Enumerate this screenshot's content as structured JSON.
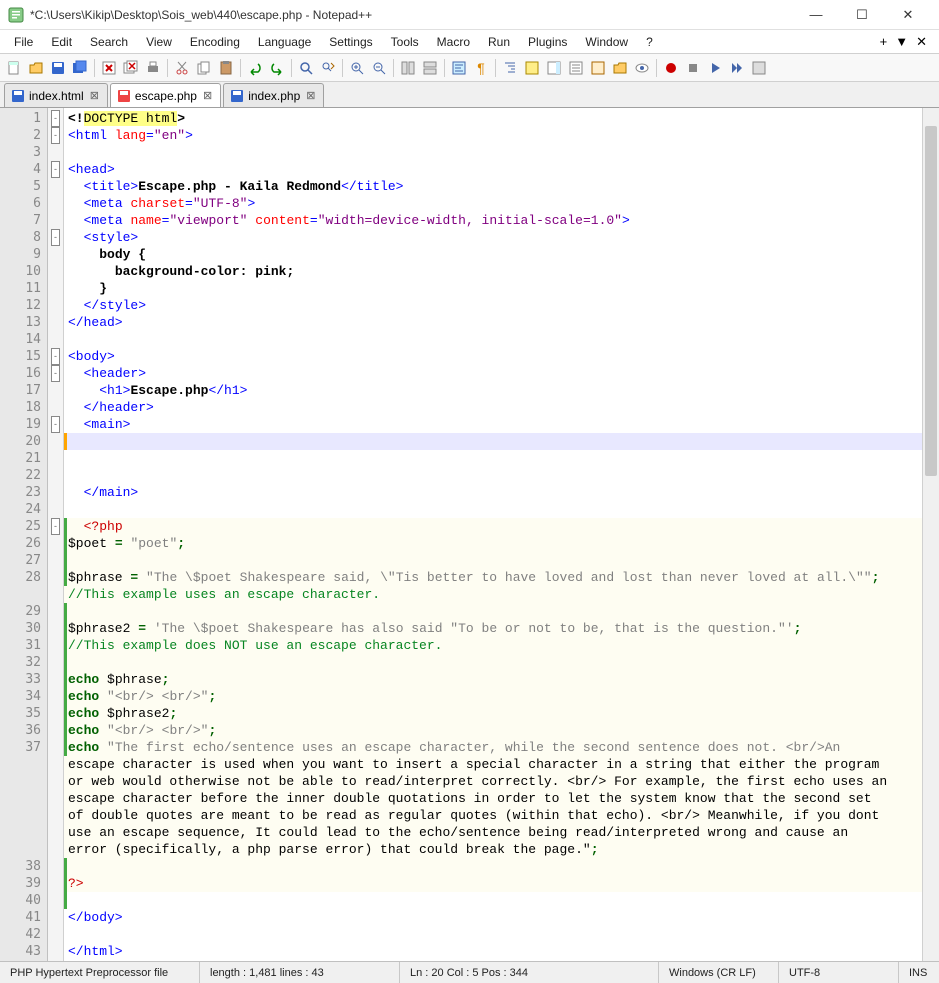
{
  "titlebar": {
    "title": "*C:\\Users\\Kikip\\Desktop\\Sois_web\\440\\escape.php - Notepad++"
  },
  "menubar": {
    "items": [
      "File",
      "Edit",
      "Search",
      "View",
      "Encoding",
      "Language",
      "Settings",
      "Tools",
      "Macro",
      "Run",
      "Plugins",
      "Window",
      "?"
    ]
  },
  "tabs": [
    {
      "label": "index.html",
      "active": false
    },
    {
      "label": "escape.php",
      "active": true
    },
    {
      "label": "index.php",
      "active": false
    }
  ],
  "code": {
    "lines": [
      {
        "n": 1,
        "fold": "-",
        "html": "<span class='t-black'>&lt;!</span><span class='t-doctype-bg'>DOCTYPE html</span><span class='t-black'>&gt;</span>"
      },
      {
        "n": 2,
        "fold": "-",
        "html": "<span class='t-blue'>&lt;html</span> <span class='t-red'>lang</span><span class='t-blue'>=</span><span class='t-purple'>\"en\"</span><span class='t-blue'>&gt;</span>"
      },
      {
        "n": 3,
        "fold": "",
        "html": ""
      },
      {
        "n": 4,
        "fold": "-",
        "html": "<span class='t-blue'>&lt;head&gt;</span>"
      },
      {
        "n": 5,
        "fold": "",
        "html": "  <span class='t-blue'>&lt;title&gt;</span><span class='t-black'>Escape.php - Kaila Redmond</span><span class='t-blue'>&lt;/title&gt;</span>"
      },
      {
        "n": 6,
        "fold": "",
        "html": "  <span class='t-blue'>&lt;meta</span> <span class='t-red'>charset</span><span class='t-blue'>=</span><span class='t-purple'>\"UTF-8\"</span><span class='t-blue'>&gt;</span>"
      },
      {
        "n": 7,
        "fold": "",
        "html": "  <span class='t-blue'>&lt;meta</span> <span class='t-red'>name</span><span class='t-blue'>=</span><span class='t-purple'>\"viewport\"</span> <span class='t-red'>content</span><span class='t-blue'>=</span><span class='t-purple'>\"width=device-width, initial-scale=1.0\"</span><span class='t-blue'>&gt;</span>"
      },
      {
        "n": 8,
        "fold": "-",
        "html": "  <span class='t-blue'>&lt;style&gt;</span>"
      },
      {
        "n": 9,
        "fold": "",
        "html": "    <span class='t-black'>body {</span>"
      },
      {
        "n": 10,
        "fold": "",
        "html": "      <span class='t-black'>background-color: pink;</span>"
      },
      {
        "n": 11,
        "fold": "",
        "html": "    <span class='t-black'>}</span>"
      },
      {
        "n": 12,
        "fold": "",
        "html": "  <span class='t-blue'>&lt;/style&gt;</span>"
      },
      {
        "n": 13,
        "fold": "",
        "html": "<span class='t-blue'>&lt;/head&gt;</span>"
      },
      {
        "n": 14,
        "fold": "",
        "html": ""
      },
      {
        "n": 15,
        "fold": "-",
        "html": "<span class='t-blue'>&lt;body&gt;</span>"
      },
      {
        "n": 16,
        "fold": "-",
        "html": "  <span class='t-blue'>&lt;header&gt;</span>"
      },
      {
        "n": 17,
        "fold": "",
        "html": "    <span class='t-blue'>&lt;h1&gt;</span><span class='t-black'>Escape.php</span><span class='t-blue'>&lt;/h1&gt;</span>"
      },
      {
        "n": 18,
        "fold": "",
        "html": "  <span class='t-blue'>&lt;/header&gt;</span>"
      },
      {
        "n": 19,
        "fold": "-",
        "html": "  <span class='t-blue'>&lt;main&gt;</span>"
      },
      {
        "n": 20,
        "fold": "",
        "cl": "cl20",
        "bar": "o",
        "html": "    "
      },
      {
        "n": 21,
        "fold": "",
        "html": ""
      },
      {
        "n": 22,
        "fold": "",
        "html": ""
      },
      {
        "n": 23,
        "fold": "",
        "html": "  <span class='t-blue'>&lt;/main&gt;</span>"
      },
      {
        "n": 24,
        "fold": "",
        "html": ""
      },
      {
        "n": 25,
        "fold": "-",
        "php": true,
        "bar": "g",
        "html": "  <span class='t-php'>&lt;?php</span>"
      },
      {
        "n": 26,
        "fold": "",
        "php": true,
        "bar": "g",
        "html": "<span class='t-var'>$poet</span> <span class='t-kw'>=</span> <span class='t-str'>\"poet\"</span><span class='t-kw'>;</span>"
      },
      {
        "n": 27,
        "fold": "",
        "php": true,
        "bar": "g",
        "html": ""
      },
      {
        "n": 28,
        "fold": "",
        "php": true,
        "bar": "g",
        "html": "<span class='t-var'>$phrase</span> <span class='t-kw'>=</span> <span class='t-str'>\"The \\$poet Shakespeare said, \\\"Tis better to have loved and lost than never loved at all.\\\"\"</span><span class='t-kw'>;</span>  <br><span class='t-comment'>//This example uses an escape character.</span>"
      },
      {
        "n": 29,
        "fold": "",
        "php": true,
        "bar": "g",
        "html": ""
      },
      {
        "n": 30,
        "fold": "",
        "php": true,
        "bar": "g",
        "html": "<span class='t-var'>$phrase2</span> <span class='t-kw'>=</span> <span class='t-str'>'The \\$poet Shakespeare has also said \"To be or not to be, that is the question.\"'</span><span class='t-kw'>;</span>"
      },
      {
        "n": 31,
        "fold": "",
        "php": true,
        "bar": "g",
        "html": "<span class='t-comment'>//This example does NOT use an escape character.</span>"
      },
      {
        "n": 32,
        "fold": "",
        "php": true,
        "bar": "g",
        "html": ""
      },
      {
        "n": 33,
        "fold": "",
        "php": true,
        "bar": "g",
        "html": "<span class='t-kw'>echo</span> <span class='t-var'>$phrase</span><span class='t-kw'>;</span>"
      },
      {
        "n": 34,
        "fold": "",
        "php": true,
        "bar": "g",
        "html": "<span class='t-kw'>echo</span> <span class='t-str'>\"&lt;br/&gt; &lt;br/&gt;\"</span><span class='t-kw'>;</span>"
      },
      {
        "n": 35,
        "fold": "",
        "php": true,
        "bar": "g",
        "html": "<span class='t-kw'>echo</span> <span class='t-var'>$phrase2</span><span class='t-kw'>;</span>"
      },
      {
        "n": 36,
        "fold": "",
        "php": true,
        "bar": "g",
        "html": "<span class='t-kw'>echo</span> <span class='t-str'>\"&lt;br/&gt; &lt;br/&gt;\"</span><span class='t-kw'>;</span>"
      },
      {
        "n": 37,
        "fold": "",
        "php": true,
        "bar": "g",
        "html": "<span class='t-kw'>echo</span> <span class='t-str'>\"The first echo/sentence uses an escape character, while the second sentence does not. &lt;br/&gt;An <br>escape character is used when you want to insert a special character in a string that either the program <br>or web would otherwise not be able to read/interpret correctly. &lt;br/&gt; For example, the first echo uses an <br>escape character before the inner double quotations in order to let the system know that the second set <br>of double quotes are meant to be read as regular quotes (within that echo). &lt;br/&gt; Meanwhile, if you dont <br>use an escape sequence, It could lead to the echo/sentence being read/interpreted wrong and cause an <br>error (specifically, a php parse error) that could break the page.\"</span><span class='t-kw'>;</span>"
      },
      {
        "n": 38,
        "fold": "",
        "php": true,
        "bar": "g",
        "html": ""
      },
      {
        "n": 39,
        "fold": "",
        "php": true,
        "bar": "g",
        "html": "<span class='t-php'>?&gt;</span>"
      },
      {
        "n": 40,
        "fold": "",
        "bar": "g",
        "html": ""
      },
      {
        "n": 41,
        "fold": "",
        "html": "<span class='t-blue'>&lt;/body&gt;</span>"
      },
      {
        "n": 42,
        "fold": "",
        "html": ""
      },
      {
        "n": 43,
        "fold": "",
        "html": "<span class='t-blue'>&lt;/html&gt;</span>"
      }
    ]
  },
  "statusbar": {
    "filetype": "PHP Hypertext Preprocessor file",
    "length": "length : 1,481    lines : 43",
    "pos": "Ln : 20    Col : 5    Pos : 344",
    "eol": "Windows (CR LF)",
    "enc": "UTF-8",
    "ins": "INS"
  }
}
